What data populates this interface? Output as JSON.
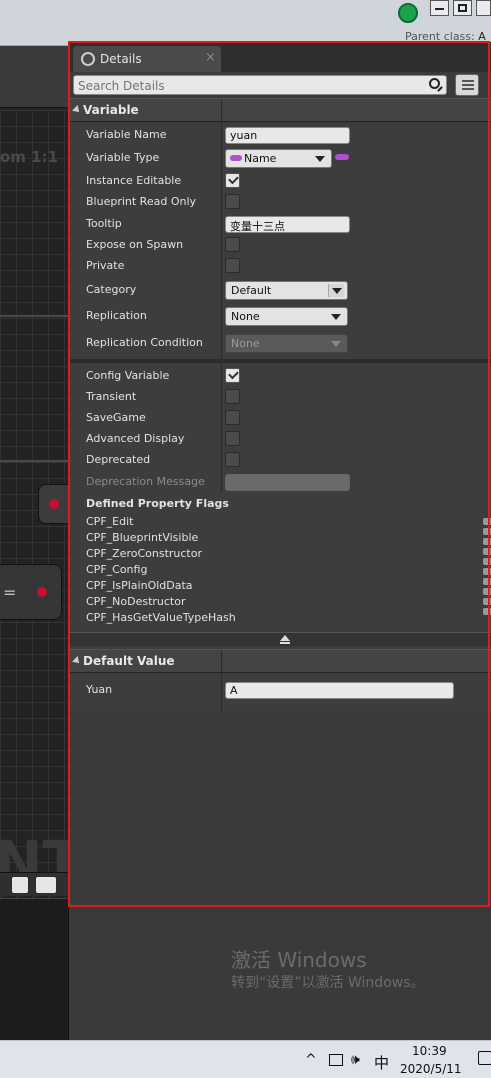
{
  "window": {
    "parent_class_label": "Parent class:",
    "parent_class_value": "A"
  },
  "graph": {
    "zoom_label": "om 1:1",
    "watermark": "NT"
  },
  "details": {
    "tab_label": "Details",
    "tab_close": "×",
    "search_placeholder": "Search Details",
    "variable_header": "Variable",
    "rows": {
      "variable_name": {
        "label": "Variable Name",
        "value": "yuan"
      },
      "variable_type": {
        "label": "Variable Type",
        "value": "Name"
      },
      "instance_editable": {
        "label": "Instance Editable",
        "checked": true
      },
      "blueprint_read_only": {
        "label": "Blueprint Read Only",
        "checked": false
      },
      "tooltip": {
        "label": "Tooltip",
        "value": "变量十三点"
      },
      "expose_on_spawn": {
        "label": "Expose on Spawn",
        "checked": false
      },
      "private": {
        "label": "Private",
        "checked": false
      },
      "category": {
        "label": "Category",
        "value": "Default"
      },
      "replication": {
        "label": "Replication",
        "value": "None"
      },
      "replication_condition": {
        "label": "Replication Condition",
        "value": "None"
      },
      "config_variable": {
        "label": "Config Variable",
        "checked": true
      },
      "transient": {
        "label": "Transient",
        "checked": false
      },
      "save_game": {
        "label": "SaveGame",
        "checked": false
      },
      "advanced_display": {
        "label": "Advanced Display",
        "checked": false
      },
      "deprecated": {
        "label": "Deprecated",
        "checked": false
      },
      "deprecation_message": {
        "label": "Deprecation Message",
        "value": ""
      }
    },
    "flags_header": "Defined Property Flags",
    "flags": [
      "CPF_Edit",
      "CPF_BlueprintVisible",
      "CPF_ZeroConstructor",
      "CPF_Config",
      "CPF_IsPlainOldData",
      "CPF_NoDestructor",
      "CPF_HasGetValueTypeHash"
    ],
    "default_value_header": "Default Value",
    "default_value": {
      "label": "Yuan",
      "value": "A"
    }
  },
  "activation": {
    "title": "激活 Windows",
    "subtitle": "转到“设置”以激活 Windows。"
  },
  "taskbar": {
    "chevron": "^",
    "ime": "中",
    "volume": "🕪",
    "time": "10:39",
    "date": "2020/5/11"
  },
  "colors": {
    "accent_outline": "#e01b1b",
    "name_type_pin": "#b050d0",
    "graph_pin": "#c8102e"
  }
}
